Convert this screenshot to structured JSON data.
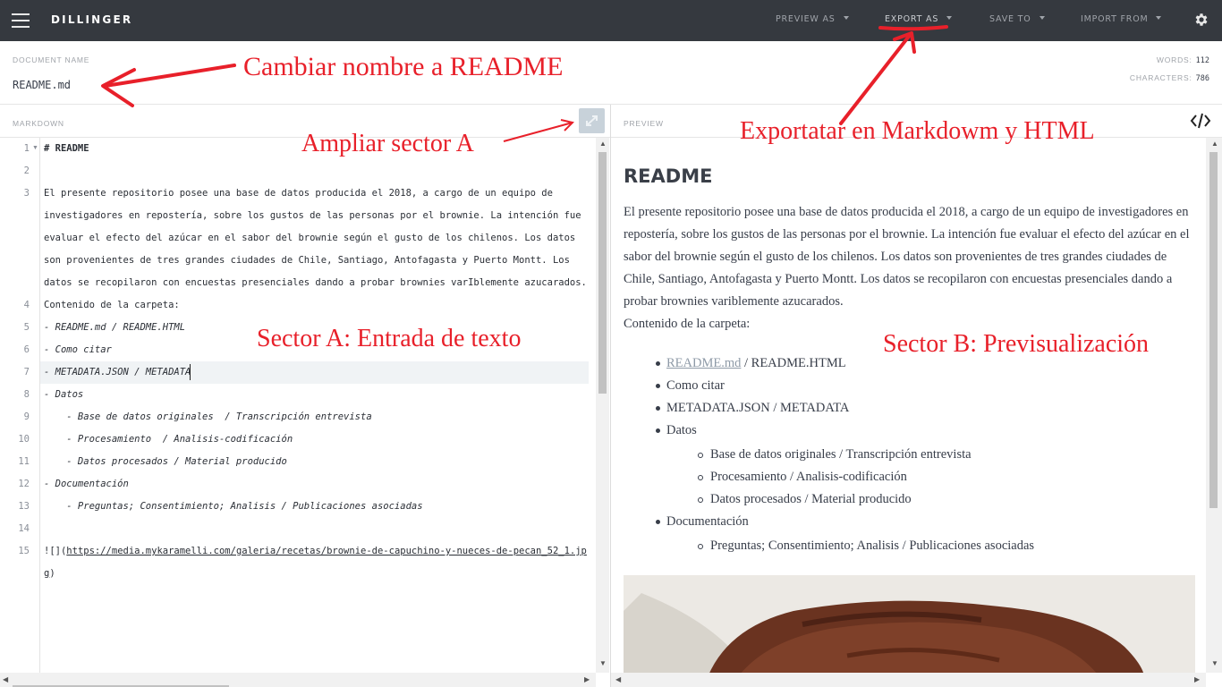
{
  "app": {
    "brand": "DILLINGER"
  },
  "topbar": {
    "menus": [
      {
        "label": "PREVIEW AS"
      },
      {
        "label": "EXPORT AS"
      },
      {
        "label": "SAVE TO"
      },
      {
        "label": "IMPORT FROM"
      }
    ],
    "icons": [
      "hamburger-icon",
      "gear-icon"
    ]
  },
  "document": {
    "label": "DOCUMENT NAME",
    "name": "README.md",
    "words_label": "WORDS:",
    "words": "112",
    "chars_label": "CHARACTERS:",
    "chars": "786"
  },
  "panes": {
    "markdown_label": "MARKDOWN",
    "preview_label": "PREVIEW"
  },
  "editor": {
    "active_line": 7,
    "lines": [
      {
        "n": "1",
        "text": "# README"
      },
      {
        "n": "2",
        "text": ""
      },
      {
        "n": "3",
        "text": "El presente repositorio posee una base de datos producida el 2018, a cargo de un equipo de"
      },
      {
        "n": "",
        "text": "investigadores en repostería, sobre los gustos de las personas por el brownie. La intención fue"
      },
      {
        "n": "",
        "text": "evaluar el efecto del azúcar en el sabor del brownie según el gusto de los chilenos. Los datos"
      },
      {
        "n": "",
        "text": "son provenientes de tres grandes ciudades de Chile, Santiago, Antofagasta y Puerto Montt. Los"
      },
      {
        "n": "",
        "text": "datos se recopilaron con encuestas presenciales dando a probar brownies varIblemente azucarados."
      },
      {
        "n": "4",
        "text": "Contenido de la carpeta:"
      },
      {
        "n": "5",
        "text": "- README.md / README.HTML"
      },
      {
        "n": "6",
        "text": "- Como citar"
      },
      {
        "n": "7",
        "text": "- METADATA.JSON / METADATA"
      },
      {
        "n": "8",
        "text": "- Datos"
      },
      {
        "n": "9",
        "text": "    - Base de datos originales  / Transcripción entrevista"
      },
      {
        "n": "10",
        "text": "    - Procesamiento  / Analisis-codificación"
      },
      {
        "n": "11",
        "text": "    - Datos procesados / Material producido"
      },
      {
        "n": "12",
        "text": "- Documentación"
      },
      {
        "n": "13",
        "text": "    - Preguntas; Consentimiento; Analisis / Publicaciones asociadas"
      },
      {
        "n": "14",
        "text": ""
      },
      {
        "n": "15",
        "text": "![](https://media.mykaramelli.com/galeria/recetas/brownie-de-capuchino-y-nueces-de-pecan_52_1.jp"
      },
      {
        "n": "",
        "text": "g)"
      }
    ]
  },
  "preview": {
    "h1": "README",
    "paragraph": "El presente repositorio posee una base de datos producida el 2018, a cargo de un equipo de investigadores en repostería, sobre los gustos de las personas por el brownie. La intención fue evaluar el efecto del azúcar en el sabor del brownie según el gusto de los chilenos. Los datos son provenientes de tres grandes ciudades de Chile, Santiago, Antofagasta y Puerto Montt. Los datos se recopilaron con encuestas presenciales dando a probar brownies variblemente azucarados.",
    "contents": "Contenido de la carpeta:",
    "item1_link": "README.md",
    "item1_rest": " / README.HTML",
    "item2": "Como citar",
    "item3": "METADATA.JSON / METADATA",
    "item4": "Datos",
    "sub1": "Base de datos originales / Transcripción entrevista",
    "sub2": "Procesamiento / Analisis-codificación",
    "sub3": "Datos procesados / Material producido",
    "item5": "Documentación",
    "sub4": "Preguntas; Consentimiento; Analisis / Publicaciones asociadas",
    "image_subject": "brownie photo"
  },
  "annotations": {
    "rename": "Cambiar nombre a README",
    "expand": "Ampliar sector A",
    "export": "Exportatar en Markdowm y HTML",
    "sector_a": "Sector A: Entrada de texto",
    "sector_b": "Sector B: Previsualización",
    "color": "#e8202a"
  }
}
